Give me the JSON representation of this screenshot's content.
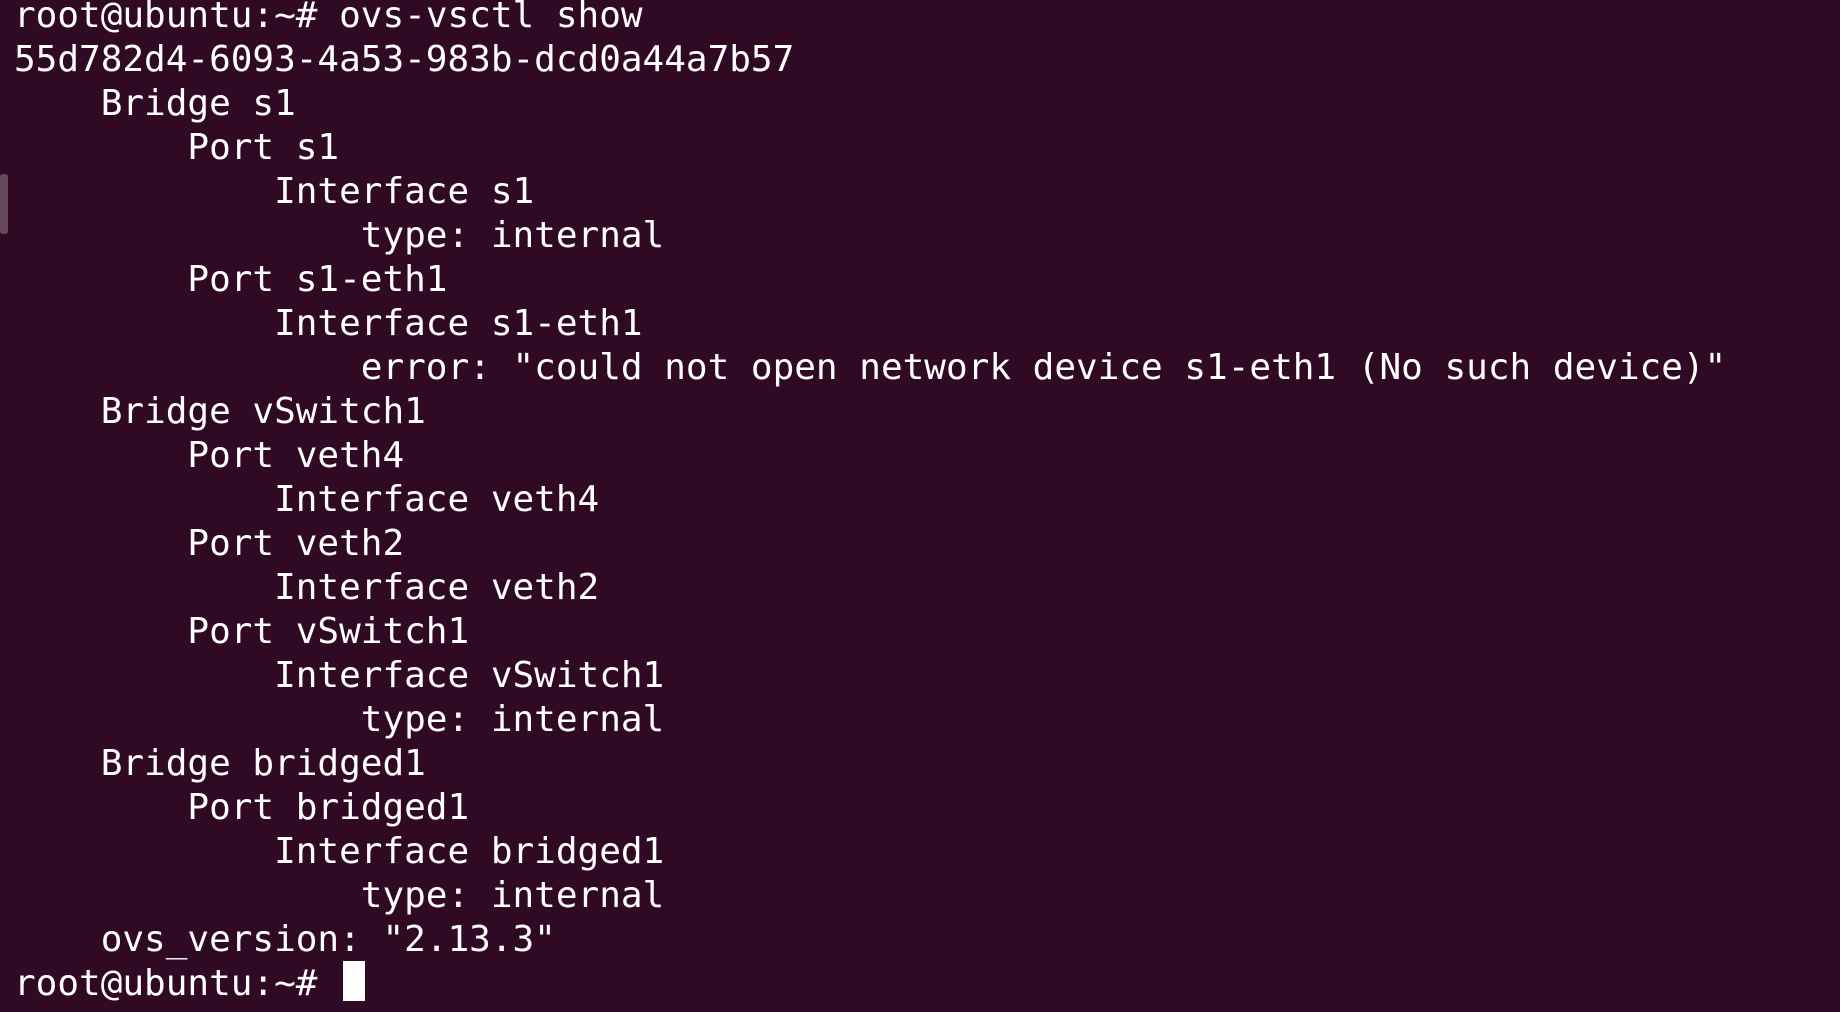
{
  "terminal": {
    "prompt": "root@ubuntu:~#",
    "command": "ovs-vsctl show",
    "output": [
      "55d782d4-6093-4a53-983b-dcd0a44a7b57",
      "    Bridge s1",
      "        Port s1",
      "            Interface s1",
      "                type: internal",
      "        Port s1-eth1",
      "            Interface s1-eth1",
      "                error: \"could not open network device s1-eth1 (No such device)\"",
      "    Bridge vSwitch1",
      "        Port veth4",
      "            Interface veth4",
      "        Port veth2",
      "            Interface veth2",
      "        Port vSwitch1",
      "            Interface vSwitch1",
      "                type: internal",
      "    Bridge bridged1",
      "        Port bridged1",
      "            Interface bridged1",
      "                type: internal",
      "    ovs_version: \"2.13.3\""
    ]
  }
}
